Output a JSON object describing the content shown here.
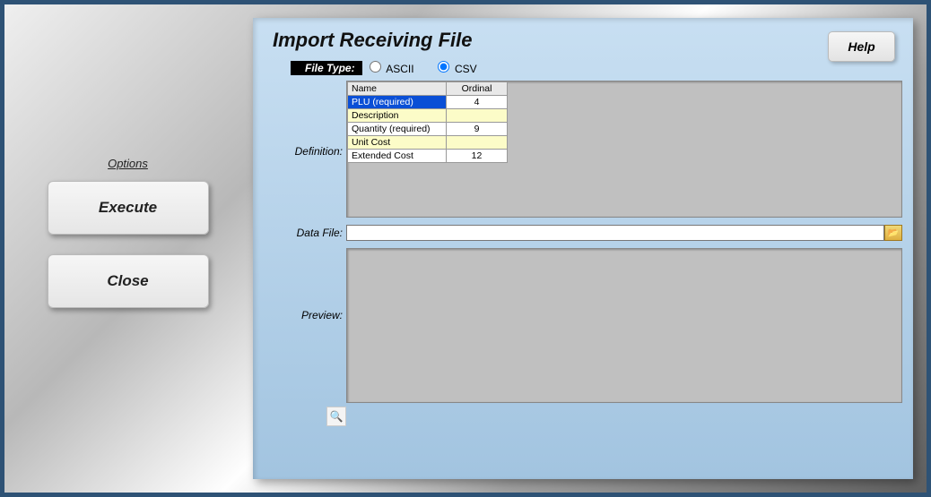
{
  "sidebar": {
    "options_label": "Options",
    "buttons": {
      "execute": "Execute",
      "close": "Close"
    }
  },
  "header": {
    "title": "Import Receiving File",
    "help_label": "Help"
  },
  "filetype": {
    "label": "File Type:",
    "options": {
      "ascii": "ASCII",
      "csv": "CSV"
    },
    "selected": "csv"
  },
  "labels": {
    "definition": "Definition:",
    "data_file": "Data File:",
    "preview": "Preview:"
  },
  "definition_table": {
    "headers": {
      "name": "Name",
      "ordinal": "Ordinal"
    },
    "rows": [
      {
        "name": "PLU (required)",
        "ordinal": "4",
        "selected": true,
        "alt": false
      },
      {
        "name": "Description",
        "ordinal": "",
        "selected": false,
        "alt": true
      },
      {
        "name": "Quantity (required)",
        "ordinal": "9",
        "selected": false,
        "alt": false
      },
      {
        "name": "Unit Cost",
        "ordinal": "",
        "selected": false,
        "alt": true
      },
      {
        "name": "Extended Cost",
        "ordinal": "12",
        "selected": false,
        "alt": false
      }
    ]
  },
  "data_file": {
    "value": ""
  },
  "icons": {
    "folder": "📁",
    "magnify": "🔍"
  }
}
